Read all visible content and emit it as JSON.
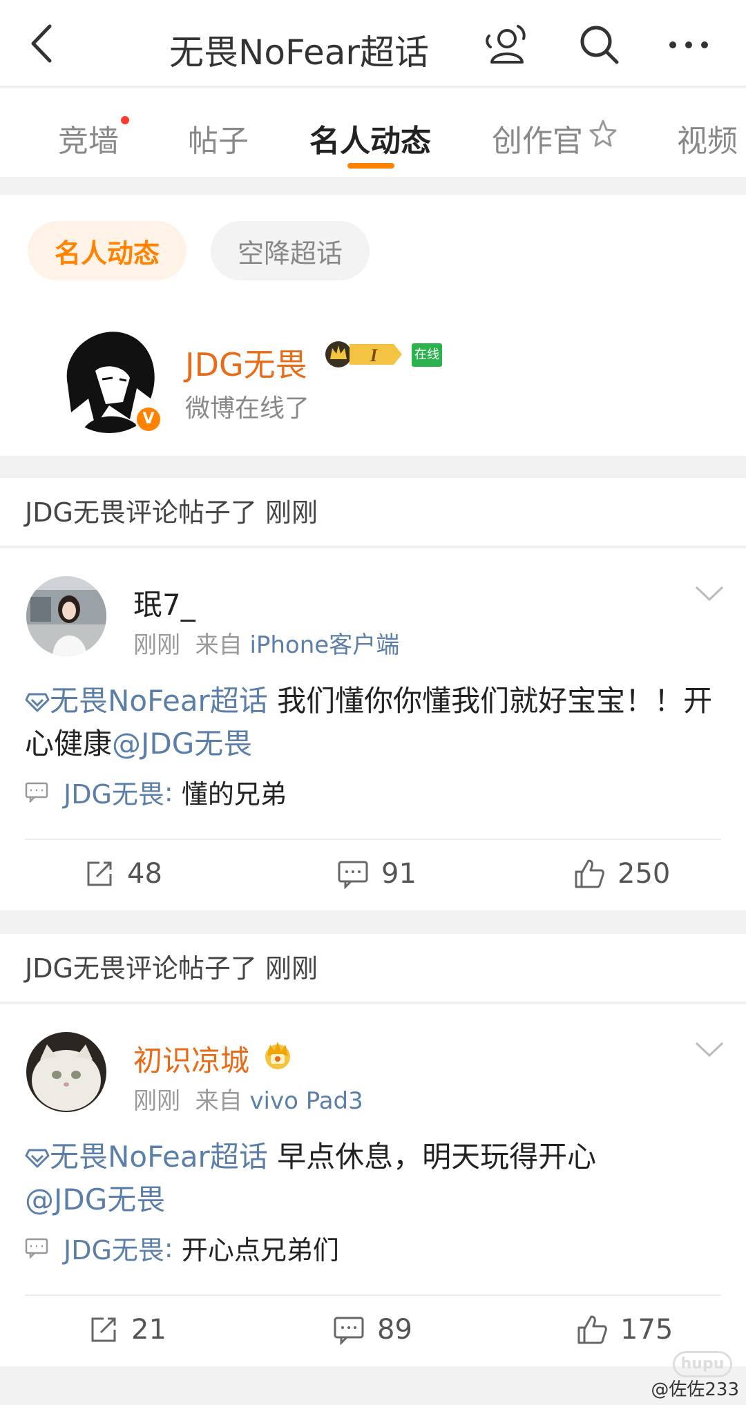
{
  "header": {
    "title": "无畏NoFear超话"
  },
  "tabs": [
    {
      "label": "竞墙",
      "dot": true
    },
    {
      "label": "帖子"
    },
    {
      "label": "名人动态",
      "active": true
    },
    {
      "label": "创作官"
    },
    {
      "label": "视频"
    }
  ],
  "filters": {
    "active": "名人动态",
    "other": "空降超话"
  },
  "celebrity": {
    "name": "JDG无畏",
    "status": "微博在线了",
    "online_badge": "在线",
    "verified": "V",
    "level": "I"
  },
  "posts": [
    {
      "header": "JDG无畏评论帖子了 刚刚",
      "user": {
        "name": "珉7_",
        "time": "刚刚",
        "from": "来自",
        "source": "iPhone客户端"
      },
      "topic": "无畏NoFear超话",
      "text": "  我们懂你你懂我们就好宝宝！！开心健康",
      "mention": "@JDG无畏",
      "reply": {
        "name": "JDG无畏",
        "sep": ":",
        "text": "懂的兄弟"
      },
      "stats": {
        "reposts": "48",
        "comments": "91",
        "likes": "250"
      }
    },
    {
      "header": "JDG无畏评论帖子了 刚刚",
      "user": {
        "name": "初识凉城",
        "time": "刚刚",
        "from": "来自",
        "source": "vivo Pad3"
      },
      "topic": "无畏NoFear超话",
      "text": "  早点休息，明天玩得开心",
      "mention": "@JDG无畏",
      "reply": {
        "name": "JDG无畏",
        "sep": ":",
        "text": "开心点兄弟们"
      },
      "stats": {
        "reposts": "21",
        "comments": "89",
        "likes": "175"
      }
    }
  ],
  "watermark": "@佐佐233",
  "hupu_logo": "hupu",
  "colors": {
    "accent": "#ff8200",
    "link": "#5b7fa8",
    "vip_name": "#e86b18"
  }
}
